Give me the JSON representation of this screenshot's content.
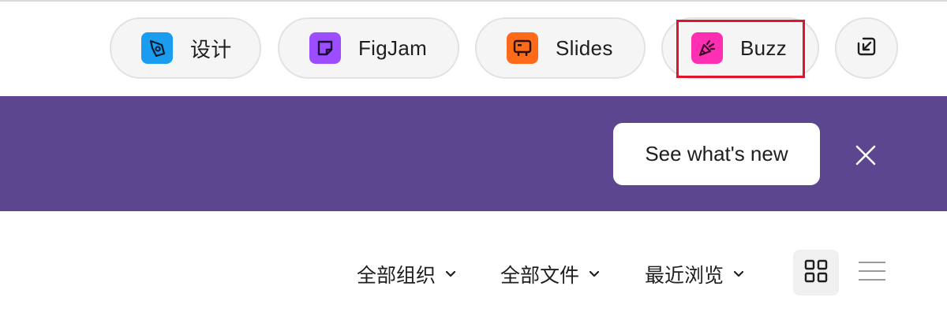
{
  "products": {
    "design": {
      "label": "设计",
      "icon": "pen-tool-icon",
      "color": "#1a9cf0"
    },
    "figjam": {
      "label": "FigJam",
      "icon": "sticky-note-icon",
      "color": "#9b4dff"
    },
    "slides": {
      "label": "Slides",
      "icon": "presentation-icon",
      "color": "#ff6a1a"
    },
    "buzz": {
      "label": "Buzz",
      "icon": "megaphone-icon",
      "color": "#ff2fb4",
      "highlighted": true
    },
    "import": {
      "icon": "import-icon"
    }
  },
  "banner": {
    "background": "#5c4690",
    "cta_label": "See what's new",
    "close_icon": "close-icon"
  },
  "filters": {
    "organization": "全部组织",
    "files": "全部文件",
    "sort": "最近浏览"
  },
  "view_toggle": {
    "selected": "grid",
    "icons": [
      "grid-view-icon",
      "list-view-icon"
    ]
  }
}
